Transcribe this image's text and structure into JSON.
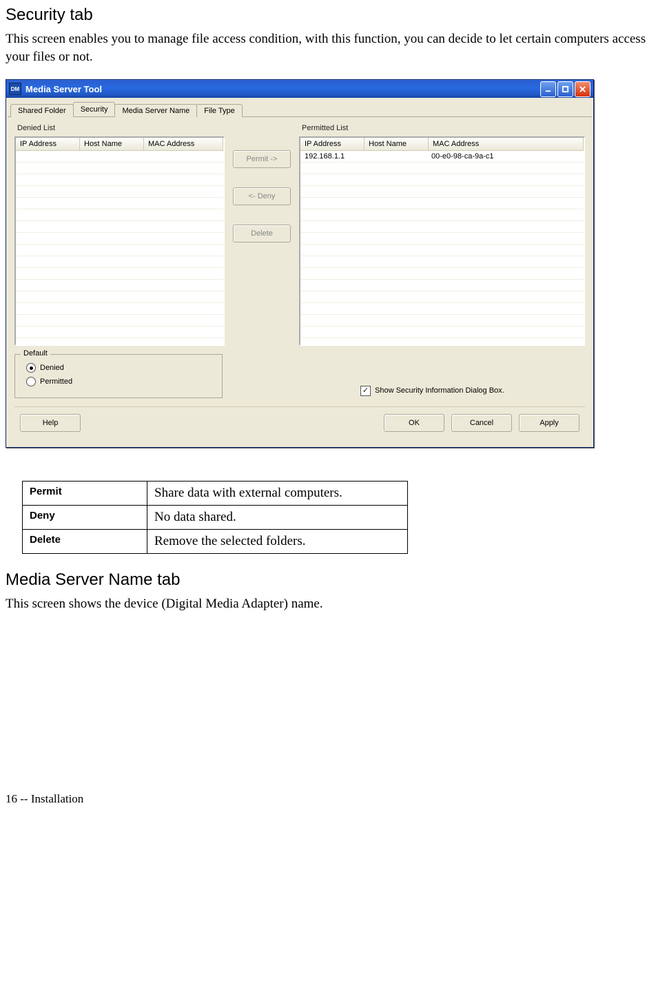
{
  "headings": {
    "security": "Security tab",
    "media_server_name": "Media Server Name tab"
  },
  "paragraphs": {
    "security_intro": "This screen enables you to manage file access condition, with this function, you can decide to let certain computers access your files or not.",
    "media_server_name_intro": "This screen shows the device (Digital Media Adapter) name."
  },
  "window": {
    "title": "Media Server Tool",
    "tabs": [
      "Shared Folder",
      "Security",
      "Media Server Name",
      "File Type"
    ],
    "active_tab_index": 1,
    "denied_label": "Denied List",
    "permitted_label": "Permitted List",
    "columns": {
      "ip": "IP Address",
      "host": "Host Name",
      "mac": "MAC Address"
    },
    "permitted_rows": [
      {
        "ip": "192.168.1.1",
        "host": "",
        "mac": "00-e0-98-ca-9a-c1"
      }
    ],
    "denied_rows": [],
    "blank_rows_denied": 16,
    "blank_rows_permitted": 15,
    "mid_buttons": {
      "permit": "Permit ->",
      "deny": "<- Deny",
      "delete": "Delete"
    },
    "default_group": {
      "legend": "Default",
      "denied": "Denied",
      "permitted": "Permitted",
      "selected": "denied"
    },
    "show_security_label": "Show Security Information Dialog Box.",
    "show_security_checked": true,
    "bottom_buttons": {
      "help": "Help",
      "ok": "OK",
      "cancel": "Cancel",
      "apply": "Apply"
    }
  },
  "defs_table": [
    {
      "term": "Permit",
      "desc": "Share data with external computers."
    },
    {
      "term": "Deny",
      "desc": "No data shared."
    },
    {
      "term": "Delete",
      "desc": "Remove the selected folders."
    }
  ],
  "footer": "16  --  Installation"
}
